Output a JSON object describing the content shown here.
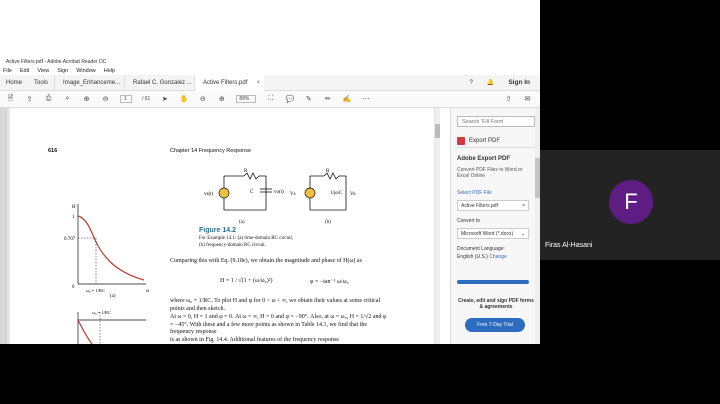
{
  "window": {
    "title": "Active Filters.pdf - Adobe Acrobat Reader DC"
  },
  "menu": [
    "File",
    "Edit",
    "View",
    "Sign",
    "Window",
    "Help"
  ],
  "tabs": {
    "home": "Home",
    "tools": "Tools",
    "docs": [
      {
        "label": "Image_Enhanceme...",
        "active": false
      },
      {
        "label": "Rafael C. Gonzalez ...",
        "active": false
      },
      {
        "label": "Active Filters.pdf",
        "active": true
      }
    ],
    "signin": "Sign In"
  },
  "toolbar": {
    "page_current": "1",
    "page_total": "/ 61",
    "zoom": "89%"
  },
  "page": {
    "page_number": "616",
    "chapter": "Chapter 14     Frequency Response",
    "fig_a": "(a)",
    "fig_b": "(b)",
    "figure_title": "Figure 14.2",
    "caption_line1": "For Example 14.1: (a) time-domain RC circuit,",
    "caption_line2": "(b) frequency-domain RC circuit.",
    "para1": "Comparing this with Eq. (9.18e), we obtain the magnitude and phase of H(ω) as",
    "eq_H": "H = 1 / √(1 + (ω/ω₀)²)",
    "eq_phi": "φ = −tan⁻¹ ω/ω₀",
    "para2": "where ω₀ = 1/RC. To plot H and φ for 0 < ω < ∞, we obtain their values at some critical points and then sketch.",
    "para3": "At ω = 0, H = 1 and φ = 0. At ω = ∞, H = 0 and φ = −90°. Also, at ω = ω₀, H = 1/√2 and φ = −45°. With these and a few more points as shown in Table 14.1, we find that the frequency response",
    "para4": "is as shown in Fig. 14.4. Additional features of the frequency response",
    "plot_fig_label": "(a)",
    "plot_H": "H",
    "plot_1": "1",
    "plot_0707": "0.707",
    "plot_0": "0",
    "plot_w0": "ω₀ = 1/RC",
    "plot_w": "ω",
    "plot_w0b": "ω₀ = 1/RC",
    "circuit_R": "R",
    "circuit_C": "C",
    "circuit_vs": "vs(t)",
    "circuit_vo": "vo(t)",
    "circuit_R2": "R",
    "circuit_Vs": "Vs",
    "circuit_Vo": "Vo",
    "circuit_jwc": "1/jωC"
  },
  "panel": {
    "search_placeholder": "Search 'Fill Form'",
    "export_pdf": "Export PDF",
    "adobe_export": "Adobe Export PDF",
    "convert_desc": "Convert PDF Files to Word or Excel Online",
    "select_file": "Select PDF File",
    "file_name": "Active Filters.pdf",
    "convert_to": "Convert to",
    "convert_value": "Microsoft Word (*.docx)",
    "doc_lang": "Document Language:",
    "lang_value": "English (U.S.)",
    "change": "Change",
    "create_desc": "Create, edit and sign PDF forms & agreements",
    "trial_btn": "Free 7-Day Trial"
  },
  "participant": {
    "initial": "F",
    "name": "Firas Al-Hasani",
    "avatar_color": "#5d1d83"
  }
}
